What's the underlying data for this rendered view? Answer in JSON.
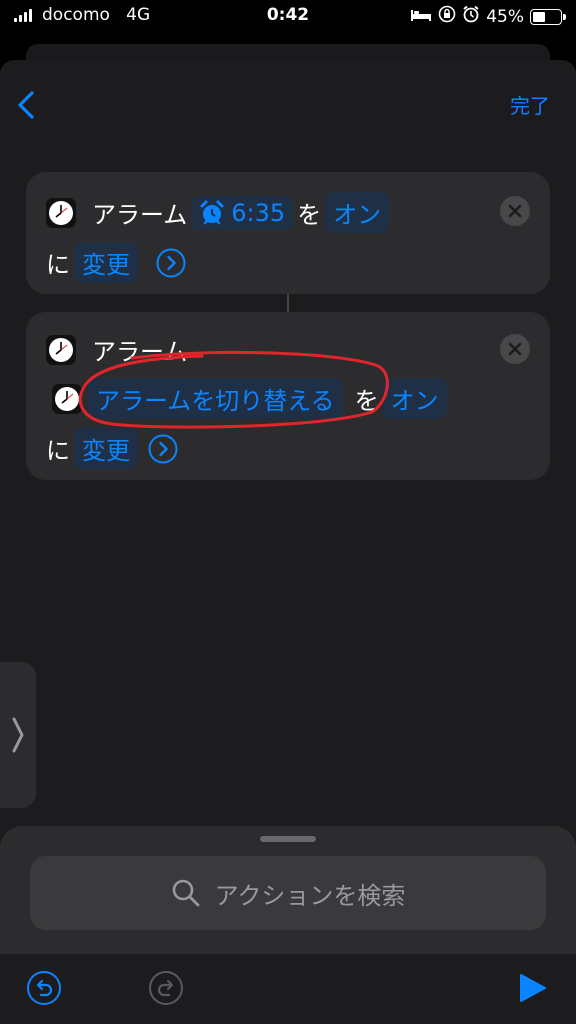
{
  "status_bar": {
    "carrier": "docomo",
    "network": "4G",
    "time": "0:42",
    "battery_percent": "45%",
    "battery_level": 0.45
  },
  "nav": {
    "done_label": "完了"
  },
  "actions": [
    {
      "title": "アラーム",
      "time_token": "6:35",
      "wo": "を",
      "state_token": "オン",
      "ni": "に",
      "change_token": "変更"
    },
    {
      "title": "アラーム",
      "param_token": "アラームを切り替える",
      "wo": "を",
      "state_token": "オン",
      "ni": "に",
      "change_token": "変更"
    }
  ],
  "search": {
    "placeholder": "アクションを検索"
  },
  "colors": {
    "accent": "#0a84ff",
    "annotation": "#e0252c",
    "card": "#2c2c2e",
    "background": "#1c1c1e"
  }
}
